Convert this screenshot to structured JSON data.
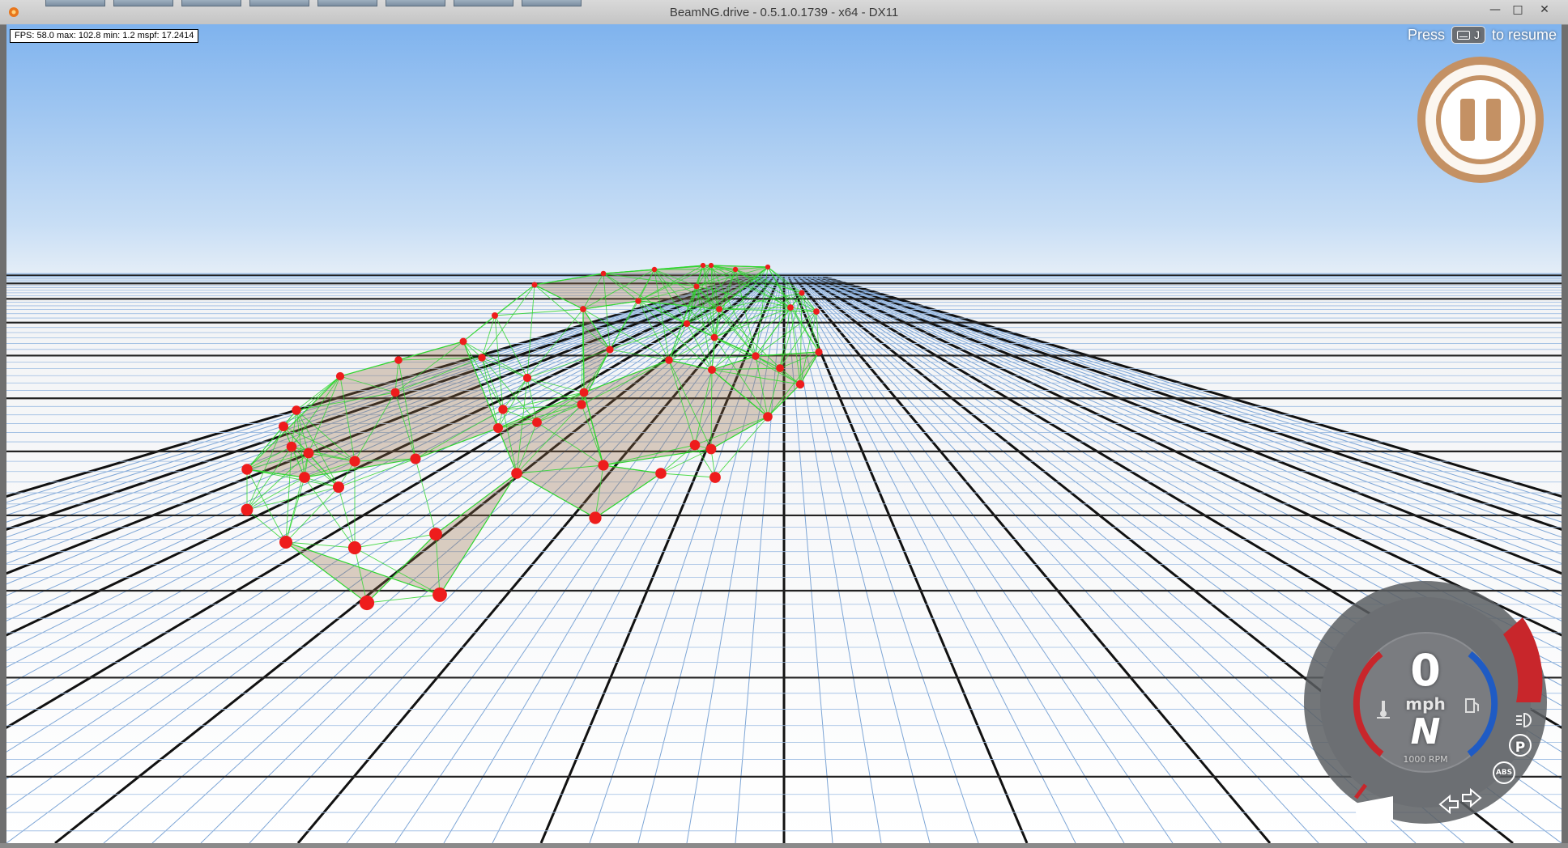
{
  "window": {
    "title": "BeamNG.drive - 0.5.1.0.1739 - x64 - DX11",
    "controls": {
      "minimize": "—",
      "maximize": "□",
      "close": "✕"
    }
  },
  "fps_overlay": "FPS:  58.0  max: 102.8  min:  1.2  mspf: 17.2414",
  "resume_hint": {
    "prefix": "Press",
    "key": "J",
    "suffix": "to resume"
  },
  "dashboard": {
    "speed": "0",
    "speed_unit": "mph",
    "gear": "N",
    "rpm": "1000 RPM",
    "abs_label": "ABS",
    "park_label": "P"
  },
  "colors": {
    "node": "#ee1c1c",
    "beam": "#2fd62f",
    "pause_ring": "#c49164",
    "redline": "#c8262b",
    "needle_blue": "#1f5bc4"
  },
  "icons": [
    "beamng-app-icon",
    "keyboard-icon",
    "pause-icon",
    "temperature-icon",
    "fuel-icon",
    "headlight-icon",
    "parking-brake-icon",
    "abs-icon",
    "turn-left-icon",
    "turn-right-icon"
  ]
}
